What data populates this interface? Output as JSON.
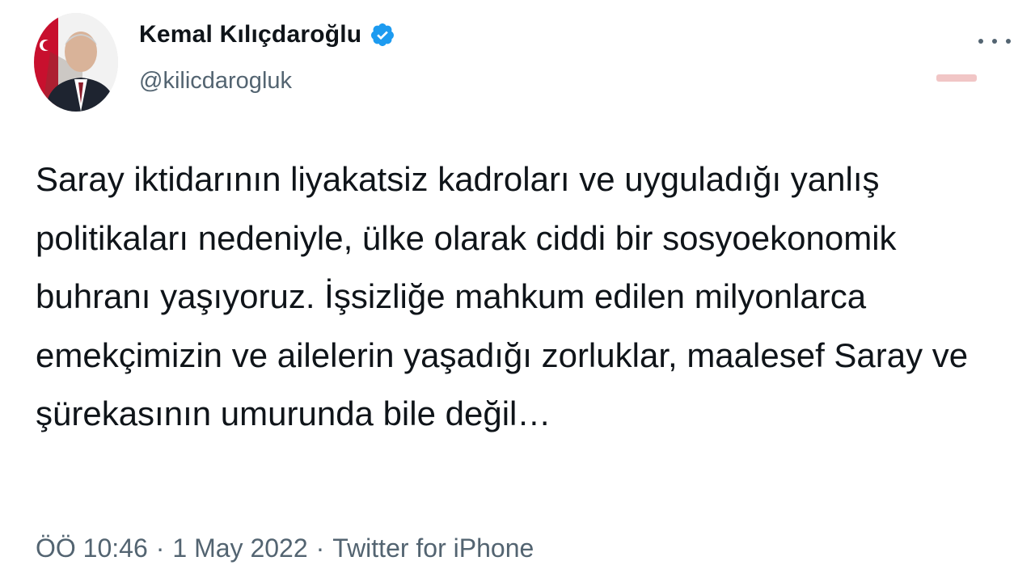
{
  "author": {
    "display_name": "Kemal Kılıçdaroğlu",
    "handle": "@kilicdarogluk",
    "verified": true
  },
  "tweet": {
    "text": "Saray iktidarının liyakatsiz kadroları ve uyguladığı yanlış politikaları nedeniyle, ülke olarak ciddi bir sosyoekonomik buhranı yaşıyoruz. İşsizliğe mahkum edilen milyonlarca emekçimizin ve ailelerin yaşadığı zorluklar, maalesef Saray ve şürekasının umurunda bile değil…"
  },
  "meta": {
    "time": "ÖÖ 10:46",
    "separator": "·",
    "date": "1 May 2022",
    "source": "Twitter for iPhone"
  },
  "icons": {
    "verified": "verified-badge-icon",
    "more": "more-options-icon"
  },
  "colors": {
    "verified_blue": "#1d9bf0",
    "secondary_text": "#536471",
    "primary_text": "#0f1419"
  }
}
